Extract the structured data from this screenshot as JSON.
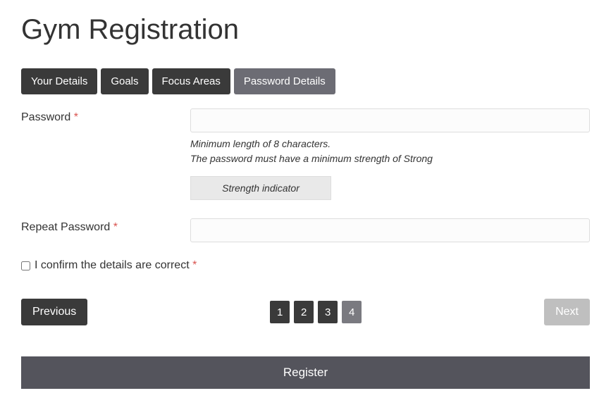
{
  "title": "Gym Registration",
  "tabs": [
    {
      "label": "Your Details",
      "active": false
    },
    {
      "label": "Goals",
      "active": false
    },
    {
      "label": "Focus Areas",
      "active": false
    },
    {
      "label": "Password Details",
      "active": true
    }
  ],
  "fields": {
    "password": {
      "label": "Password",
      "required": "*",
      "hint1": "Minimum length of 8 characters.",
      "hint2": "The password must have a minimum strength of Strong",
      "strength_label": "Strength indicator"
    },
    "repeat": {
      "label": "Repeat Password",
      "required": "*"
    },
    "confirm": {
      "label": "I confirm the details are correct",
      "required": "*"
    }
  },
  "pager": {
    "prev": "Previous",
    "next": "Next",
    "pages": [
      "1",
      "2",
      "3",
      "4"
    ],
    "current": 4
  },
  "register": "Register"
}
